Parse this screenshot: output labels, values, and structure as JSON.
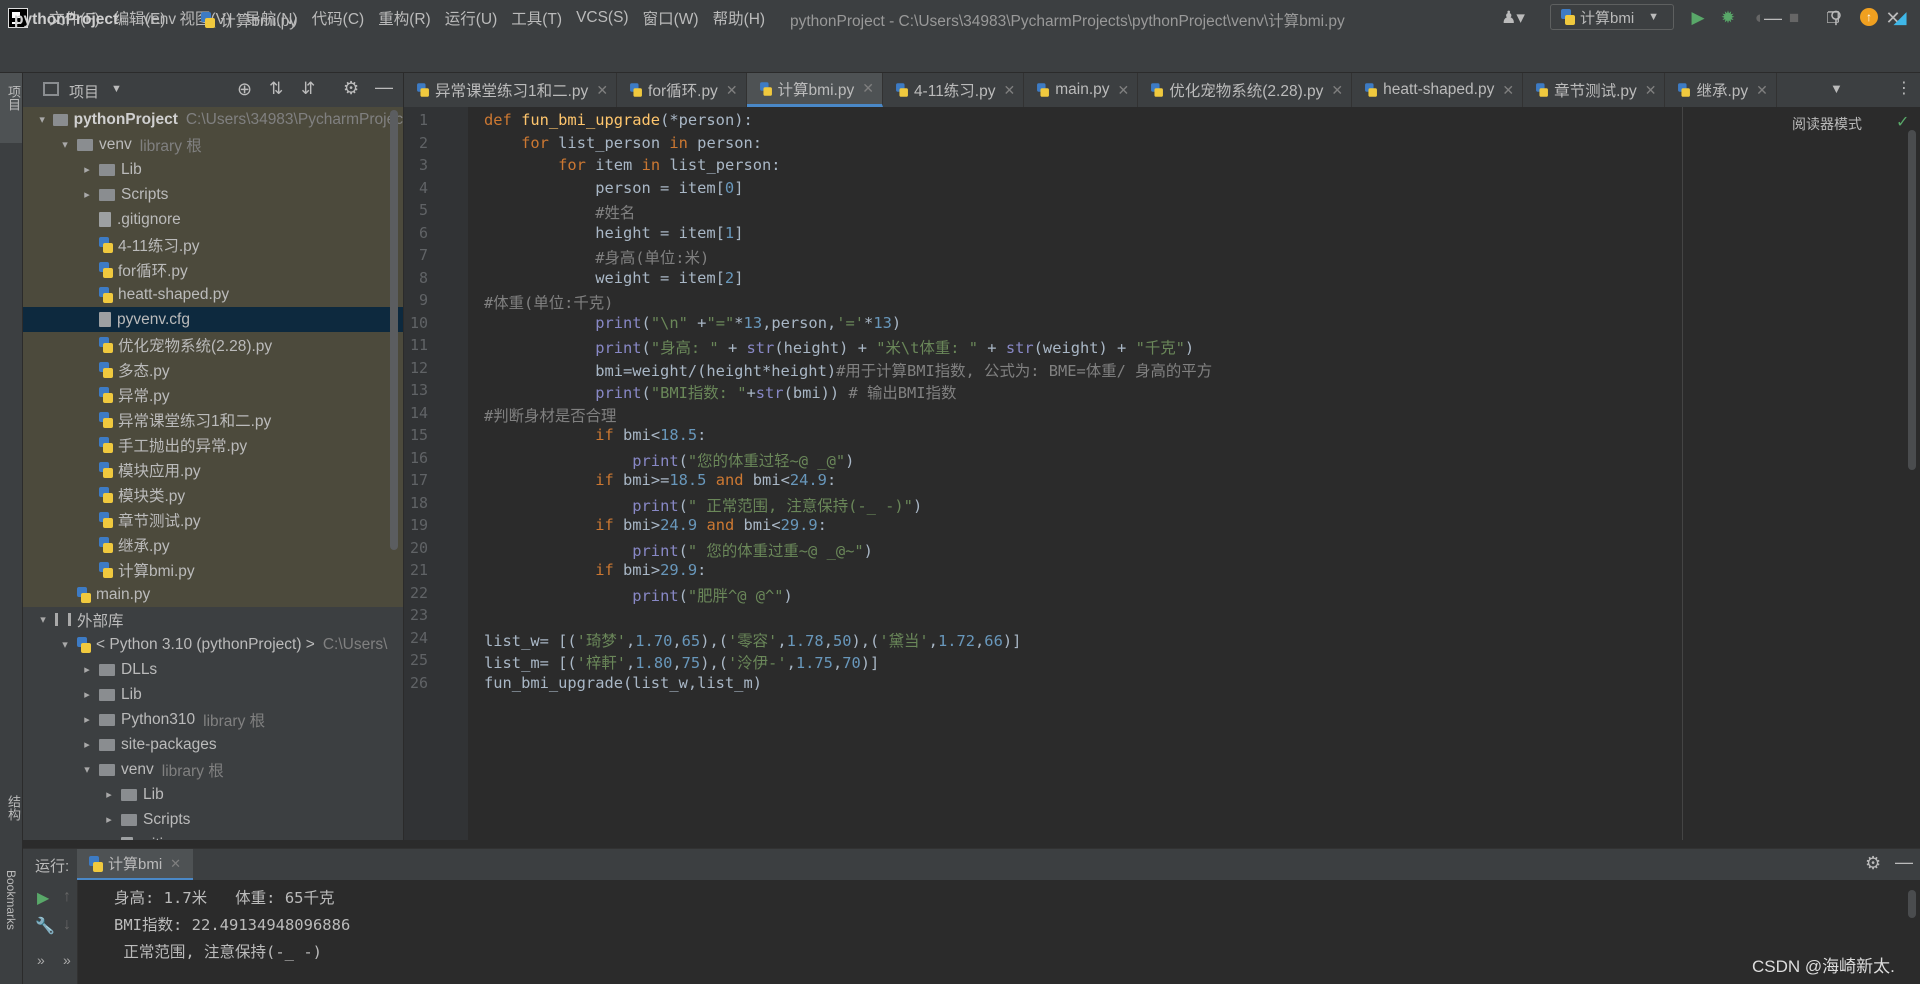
{
  "menu": [
    "文件(F)",
    "编辑(E)",
    "视图(V)",
    "导航(N)",
    "代码(C)",
    "重构(R)",
    "运行(U)",
    "工具(T)",
    "VCS(S)",
    "窗口(W)",
    "帮助(H)"
  ],
  "window_title": "pythonProject - C:\\Users\\34983\\PycharmProjects\\pythonProject\\venv\\计算bmi.py",
  "breadcrumb": [
    "pythonProject",
    "venv",
    "计算bmi.py"
  ],
  "run_config": "计算bmi",
  "left_strip": {
    "project": "项目",
    "structure": "结构",
    "bookmarks": "Bookmarks"
  },
  "project_panel": {
    "title": "项目"
  },
  "tree": [
    {
      "indent": 0,
      "arrow": "▾",
      "icon": "folder",
      "label": "pythonProject",
      "hint": "C:\\Users\\34983\\PycharmProjects"
    },
    {
      "indent": 1,
      "arrow": "▾",
      "icon": "folder",
      "label": "venv",
      "hint": "library 根"
    },
    {
      "indent": 2,
      "arrow": "▸",
      "icon": "folder",
      "label": "Lib",
      "hint": ""
    },
    {
      "indent": 2,
      "arrow": "▸",
      "icon": "folder",
      "label": "Scripts",
      "hint": ""
    },
    {
      "indent": 2,
      "arrow": "",
      "icon": "txt",
      "label": ".gitignore",
      "hint": ""
    },
    {
      "indent": 2,
      "arrow": "",
      "icon": "py",
      "label": "4-11练习.py",
      "hint": ""
    },
    {
      "indent": 2,
      "arrow": "",
      "icon": "py",
      "label": "for循环.py",
      "hint": ""
    },
    {
      "indent": 2,
      "arrow": "",
      "icon": "py",
      "label": "heatt-shaped.py",
      "hint": ""
    },
    {
      "indent": 2,
      "arrow": "",
      "icon": "txt",
      "label": "pyvenv.cfg",
      "hint": "",
      "selected": true
    },
    {
      "indent": 2,
      "arrow": "",
      "icon": "py",
      "label": "优化宠物系统(2.28).py",
      "hint": ""
    },
    {
      "indent": 2,
      "arrow": "",
      "icon": "py",
      "label": "多态.py",
      "hint": ""
    },
    {
      "indent": 2,
      "arrow": "",
      "icon": "py",
      "label": "异常.py",
      "hint": ""
    },
    {
      "indent": 2,
      "arrow": "",
      "icon": "py",
      "label": "异常课堂练习1和二.py",
      "hint": ""
    },
    {
      "indent": 2,
      "arrow": "",
      "icon": "py",
      "label": "手工抛出的异常.py",
      "hint": ""
    },
    {
      "indent": 2,
      "arrow": "",
      "icon": "py",
      "label": "模块应用.py",
      "hint": ""
    },
    {
      "indent": 2,
      "arrow": "",
      "icon": "py",
      "label": "模块类.py",
      "hint": ""
    },
    {
      "indent": 2,
      "arrow": "",
      "icon": "py",
      "label": "章节测试.py",
      "hint": ""
    },
    {
      "indent": 2,
      "arrow": "",
      "icon": "py",
      "label": "继承.py",
      "hint": ""
    },
    {
      "indent": 2,
      "arrow": "",
      "icon": "py",
      "label": "计算bmi.py",
      "hint": ""
    },
    {
      "indent": 1,
      "arrow": "",
      "icon": "py",
      "label": "main.py",
      "hint": ""
    },
    {
      "indent": 0,
      "arrow": "▾",
      "icon": "lib",
      "label": "外部库",
      "hint": ""
    },
    {
      "indent": 1,
      "arrow": "▾",
      "icon": "py",
      "label": "< Python 3.10 (pythonProject) >",
      "hint": "C:\\Users\\"
    },
    {
      "indent": 2,
      "arrow": "▸",
      "icon": "folder",
      "label": "DLLs",
      "hint": ""
    },
    {
      "indent": 2,
      "arrow": "▸",
      "icon": "folder",
      "label": "Lib",
      "hint": ""
    },
    {
      "indent": 2,
      "arrow": "▸",
      "icon": "folder",
      "label": "Python310",
      "hint": "library 根"
    },
    {
      "indent": 2,
      "arrow": "▸",
      "icon": "folder",
      "label": "site-packages",
      "hint": ""
    },
    {
      "indent": 2,
      "arrow": "▾",
      "icon": "folder",
      "label": "venv",
      "hint": "library 根"
    },
    {
      "indent": 3,
      "arrow": "▸",
      "icon": "folder",
      "label": "Lib",
      "hint": ""
    },
    {
      "indent": 3,
      "arrow": "▸",
      "icon": "folder",
      "label": "Scripts",
      "hint": ""
    },
    {
      "indent": 3,
      "arrow": "",
      "icon": "txt",
      "label": ".gitignore",
      "hint": ""
    }
  ],
  "tabs": [
    {
      "label": "异常课堂练习1和二.py",
      "active": false
    },
    {
      "label": "for循环.py",
      "active": false
    },
    {
      "label": "计算bmi.py",
      "active": true
    },
    {
      "label": "4-11练习.py",
      "active": false
    },
    {
      "label": "main.py",
      "active": false
    },
    {
      "label": "优化宠物系统(2.28).py",
      "active": false
    },
    {
      "label": "heatt-shaped.py",
      "active": false
    },
    {
      "label": "章节测试.py",
      "active": false
    },
    {
      "label": "继承.py",
      "active": false
    }
  ],
  "reader_mode": "阅读器模式",
  "code_lines": [
    [
      [
        "kw",
        "def "
      ],
      [
        "fn",
        "fun_bmi_upgrade"
      ],
      [
        "",
        "(*person):"
      ]
    ],
    [
      [
        "",
        "    "
      ],
      [
        "kw",
        "for "
      ],
      [
        "",
        "list_person "
      ],
      [
        "kw",
        "in "
      ],
      [
        "",
        "person:"
      ]
    ],
    [
      [
        "",
        "        "
      ],
      [
        "kw",
        "for "
      ],
      [
        "",
        "item "
      ],
      [
        "kw",
        "in "
      ],
      [
        "",
        "list_person:"
      ]
    ],
    [
      [
        "",
        "            person = item["
      ],
      [
        "num",
        "0"
      ],
      [
        "",
        "]"
      ]
    ],
    [
      [
        "",
        "            "
      ],
      [
        "cm",
        "#姓名"
      ]
    ],
    [
      [
        "",
        "            height = item["
      ],
      [
        "num",
        "1"
      ],
      [
        "",
        "]"
      ]
    ],
    [
      [
        "",
        "            "
      ],
      [
        "cm",
        "#身高(单位:米)"
      ]
    ],
    [
      [
        "",
        "            weight = item["
      ],
      [
        "num",
        "2"
      ],
      [
        "",
        "]"
      ]
    ],
    [
      [
        "cm",
        "#体重(单位:千克)"
      ]
    ],
    [
      [
        "",
        "            "
      ],
      [
        "bi",
        "print"
      ],
      [
        "",
        "("
      ],
      [
        "str",
        "\"\\n\" "
      ],
      [
        "",
        "+"
      ],
      [
        "str",
        "\"=\""
      ],
      [
        "",
        "*"
      ],
      [
        "num",
        "13"
      ],
      [
        "",
        ",person,"
      ],
      [
        "str",
        "'='"
      ],
      [
        "",
        "*"
      ],
      [
        "num",
        "13"
      ],
      [
        "",
        ")"
      ]
    ],
    [
      [
        "",
        "            "
      ],
      [
        "bi",
        "print"
      ],
      [
        "",
        "("
      ],
      [
        "str",
        "\"身高: \" "
      ],
      [
        "",
        "+ "
      ],
      [
        "bi",
        "str"
      ],
      [
        "",
        "(height) + "
      ],
      [
        "str",
        "\"米\\t体重: \" "
      ],
      [
        "",
        "+ "
      ],
      [
        "bi",
        "str"
      ],
      [
        "",
        "(weight) + "
      ],
      [
        "str",
        "\"千克\""
      ],
      [
        "",
        ")"
      ]
    ],
    [
      [
        "",
        "            bmi=weight/(height*height)"
      ],
      [
        "cm",
        "#用于计算BMI指数, 公式为: BME=体重/ 身高的平方"
      ]
    ],
    [
      [
        "",
        "            "
      ],
      [
        "bi",
        "print"
      ],
      [
        "",
        "("
      ],
      [
        "str",
        "\"BMI指数: \""
      ],
      [
        "",
        "+"
      ],
      [
        "bi",
        "str"
      ],
      [
        "",
        "(bmi)) "
      ],
      [
        "cm",
        "# 输出BMI指数"
      ]
    ],
    [
      [
        "cm",
        "#判断身材是否合理"
      ]
    ],
    [
      [
        "",
        "            "
      ],
      [
        "kw",
        "if "
      ],
      [
        "",
        "bmi<"
      ],
      [
        "num",
        "18.5"
      ],
      [
        "",
        ":"
      ]
    ],
    [
      [
        "",
        "                "
      ],
      [
        "bi",
        "print"
      ],
      [
        "",
        "("
      ],
      [
        "str",
        "\"您的体重过轻~@ _@\""
      ],
      [
        "",
        ")"
      ]
    ],
    [
      [
        "",
        "            "
      ],
      [
        "kw",
        "if "
      ],
      [
        "",
        "bmi>="
      ],
      [
        "num",
        "18.5 "
      ],
      [
        "kw",
        "and "
      ],
      [
        "",
        "bmi<"
      ],
      [
        "num",
        "24.9"
      ],
      [
        "",
        ":"
      ]
    ],
    [
      [
        "",
        "                "
      ],
      [
        "bi",
        "print"
      ],
      [
        "",
        "("
      ],
      [
        "str",
        "\" 正常范围, 注意保持(-_ -)\""
      ],
      [
        "",
        ")"
      ]
    ],
    [
      [
        "",
        "            "
      ],
      [
        "kw",
        "if "
      ],
      [
        "",
        "bmi>"
      ],
      [
        "num",
        "24.9 "
      ],
      [
        "kw",
        "and "
      ],
      [
        "",
        "bmi<"
      ],
      [
        "num",
        "29.9"
      ],
      [
        "",
        ":"
      ]
    ],
    [
      [
        "",
        "                "
      ],
      [
        "bi",
        "print"
      ],
      [
        "",
        "("
      ],
      [
        "str",
        "\" 您的体重过重~@ _@~\""
      ],
      [
        "",
        ")"
      ]
    ],
    [
      [
        "",
        "            "
      ],
      [
        "kw",
        "if "
      ],
      [
        "",
        "bmi>"
      ],
      [
        "num",
        "29.9"
      ],
      [
        "",
        ":"
      ]
    ],
    [
      [
        "",
        "                "
      ],
      [
        "bi",
        "print"
      ],
      [
        "",
        "("
      ],
      [
        "str",
        "\"肥胖^@ @^\""
      ],
      [
        "",
        ")"
      ]
    ],
    [
      [
        "",
        ""
      ]
    ],
    [
      [
        "",
        "list_w= [("
      ],
      [
        "str",
        "'琦梦'"
      ],
      [
        "",
        ","
      ],
      [
        "num",
        "1.70"
      ],
      [
        "",
        ","
      ],
      [
        "num",
        "65"
      ],
      [
        "",
        "),("
      ],
      [
        "str",
        "'零容'"
      ],
      [
        "",
        ","
      ],
      [
        "num",
        "1.78"
      ],
      [
        "",
        ","
      ],
      [
        "num",
        "50"
      ],
      [
        "",
        "),("
      ],
      [
        "str",
        "'黛当'"
      ],
      [
        "",
        ","
      ],
      [
        "num",
        "1.72"
      ],
      [
        "",
        ","
      ],
      [
        "num",
        "66"
      ],
      [
        "",
        ")]"
      ]
    ],
    [
      [
        "",
        "list_m= [("
      ],
      [
        "str",
        "'梓軒'"
      ],
      [
        "",
        ","
      ],
      [
        "num",
        "1.80"
      ],
      [
        "",
        ","
      ],
      [
        "num",
        "75"
      ],
      [
        "",
        "),("
      ],
      [
        "str",
        "'泠伊-'"
      ],
      [
        "",
        ","
      ],
      [
        "num",
        "1.75"
      ],
      [
        "",
        ","
      ],
      [
        "num",
        "70"
      ],
      [
        "",
        ")]"
      ]
    ],
    [
      [
        "",
        "fun_bmi_upgrade(list_w,list_m)"
      ]
    ]
  ],
  "run_panel": {
    "label": "运行:",
    "tab": "计算bmi",
    "output": [
      "身高: 1.7米   体重: 65千克",
      "BMI指数: 22.49134948096886",
      " 正常范围, 注意保持(-_ -)"
    ]
  },
  "watermark": "CSDN @海崎新太."
}
